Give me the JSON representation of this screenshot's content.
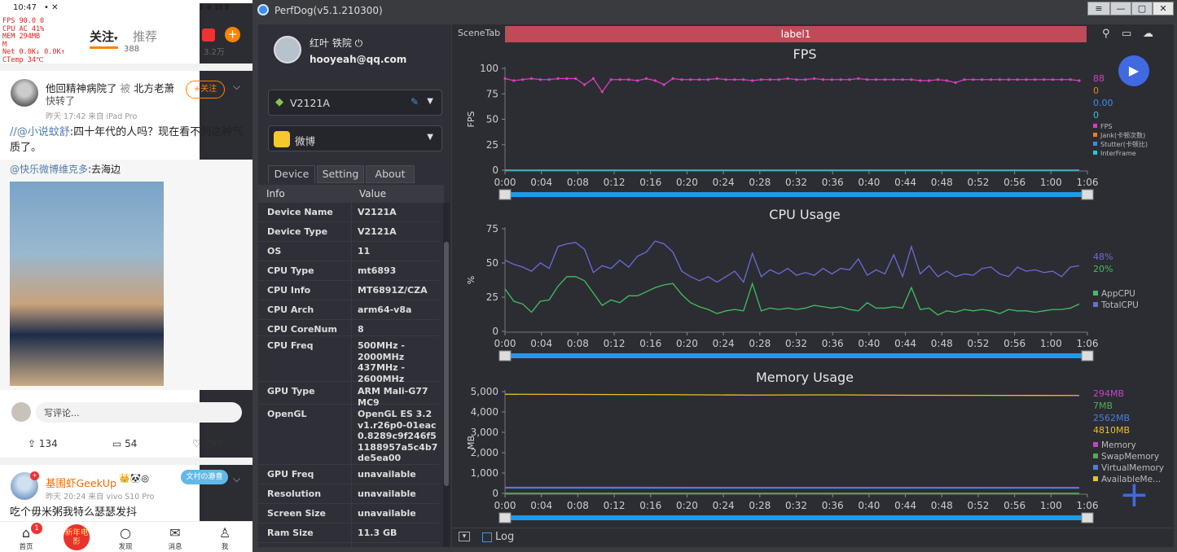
{
  "phone": {
    "status_time": "10:47",
    "status_icons": "• ✕",
    "status_right": "▮ ◉ ▮▮ ▮",
    "overlay": [
      "FPS  90.0  0",
      "CPU  AC  41%",
      "MEM  294MB",
      "M",
      "Net  0.0K↓  0.0K↑",
      "CTemp 34℃"
    ],
    "tab_active": "关注",
    "tab_arrow": "▾",
    "tab_other": "推荐",
    "plus": "+",
    "prev_counts": [
      "388",
      "3.2万"
    ],
    "post1": {
      "name": "他回精神病院了",
      "by": "被",
      "name2": "北方老萧",
      "action": "快转了",
      "meta": "昨天 17:42  来自 iPad Pro",
      "follow": "+关注",
      "text_mention": "//@小说蚊舒",
      "text_body": ":四十年代的人吗？现在看不到这种气质了。",
      "repost_mention": "@快乐微博维克多",
      "repost_body": ":去海边",
      "comment_placeholder": "写评论...",
      "reposts": "134",
      "comments": "54",
      "likes": "297"
    },
    "post2": {
      "name": "基围虾GeekUp",
      "emoji": "👑🐼◎",
      "meta": "昨天 20:24  来自 vivo S10 Pro",
      "text": "吃个毋米粥我特么瑟瑟发抖",
      "stamp": "文村の瀞豊"
    },
    "bottom_nav": [
      {
        "label": "首页",
        "icon": "⌂"
      },
      {
        "label": "",
        "icon": ""
      },
      {
        "label": "发现",
        "icon": "○"
      },
      {
        "label": "消息",
        "icon": "✉"
      },
      {
        "label": "我",
        "icon": "♙"
      }
    ],
    "home_badge": "1",
    "center_badge": "新年电影"
  },
  "app": {
    "title": "PerfDog(v5.1.210300)",
    "win_buttons": [
      "≡",
      "—",
      "▢",
      "✕"
    ],
    "user_name": "红叶 铁院 ⏻",
    "user_email": "hooyeah@qq.com",
    "device": "V2121A",
    "device_icon": "✎",
    "dd_arrow": "▼",
    "app_name": "微博",
    "tabs": [
      "Device",
      "Setting",
      "About"
    ],
    "table_headers": [
      "Info",
      "Value"
    ],
    "rows": [
      {
        "k": "Device Name",
        "v": "V2121A"
      },
      {
        "k": "Device Type",
        "v": "V2121A"
      },
      {
        "k": "OS",
        "v": "11"
      },
      {
        "k": "CPU Type",
        "v": "mt6893"
      },
      {
        "k": "CPU Info",
        "v": "MT6891Z/CZA"
      },
      {
        "k": "CPU Arch",
        "v": "arm64-v8a"
      },
      {
        "k": "CPU CoreNum",
        "v": "8"
      },
      {
        "k": "CPU Freq",
        "v": "500MHz - 2000MHz 437MHz - 2600MHz"
      },
      {
        "k": "GPU Type",
        "v": "ARM Mali-G77 MC9"
      },
      {
        "k": "OpenGL",
        "v": "OpenGL ES 3.2 v1.r26p0-01eac0.8289c9f246f51188957a5c4b7de5ea00"
      },
      {
        "k": "GPU Freq",
        "v": "unavailable"
      },
      {
        "k": "Resolution",
        "v": "unavailable"
      },
      {
        "k": "Screen Size",
        "v": "unavailable"
      },
      {
        "k": "Ram Size",
        "v": "11.3 GB"
      }
    ],
    "scene_tab": "SceneTab",
    "label1": "label1",
    "top_icons": [
      "⚲",
      "▭",
      "☁"
    ],
    "play": "▶",
    "plus_btn": "+",
    "log_label": "Log",
    "log_arrow": "▾",
    "colors": {
      "fps": "#d63fbd",
      "jank": "#f07e1e",
      "stutter": "#3a8ee6",
      "interframe": "#26c6da",
      "appcpu": "#3fbf5f",
      "totalcpu": "#6b6bd6",
      "memory": "#c542c9",
      "swap": "#4caf50",
      "virtual": "#4a7ee0",
      "available": "#e6c229",
      "slider": "#1e9be8"
    }
  },
  "chart_data": [
    {
      "type": "line",
      "title": "FPS",
      "ylabel": "FPS",
      "ylim": [
        0,
        100
      ],
      "yticks": [
        0,
        25,
        50,
        75,
        100
      ],
      "xticks": [
        "0:00",
        "0:04",
        "0:08",
        "0:12",
        "0:16",
        "0:20",
        "0:24",
        "0:28",
        "0:32",
        "0:36",
        "0:40",
        "0:44",
        "0:48",
        "0:52",
        "0:56",
        "1:00",
        "1:06"
      ],
      "x_max_seconds": 66,
      "series": [
        {
          "name": "FPS",
          "label_sub": "",
          "color": "#d63fbd",
          "last": "88",
          "values": [
            90,
            88,
            89,
            90,
            89,
            89,
            90,
            90,
            90,
            84,
            90,
            77,
            89,
            89,
            89,
            88,
            90,
            88,
            84,
            90,
            89,
            89,
            89,
            89,
            90,
            89,
            89,
            89,
            88,
            89,
            89,
            89,
            90,
            89,
            89,
            90,
            89,
            89,
            89,
            89,
            90,
            89,
            89,
            89,
            89,
            89,
            89,
            88,
            88,
            89,
            88,
            86,
            89,
            89,
            89,
            89,
            89,
            89,
            89,
            89,
            89,
            89,
            89,
            89,
            89,
            88
          ]
        },
        {
          "name": "Jank",
          "label_sub": "(卡顿次数)",
          "color": "#f07e1e",
          "last": "0",
          "values": [
            0,
            0
          ]
        },
        {
          "name": "Stutter",
          "label_sub": "(卡顿比)",
          "color": "#3a8ee6",
          "last": "0.00",
          "values": [
            0,
            0
          ]
        },
        {
          "name": "InterFrame",
          "label_sub": "",
          "color": "#26c6da",
          "last": "0",
          "values": [
            0,
            0
          ]
        }
      ]
    },
    {
      "type": "line",
      "title": "CPU Usage",
      "ylabel": "%",
      "ylim": [
        0,
        75
      ],
      "yticks": [
        0,
        25,
        50,
        75
      ],
      "xticks": [
        "0:00",
        "0:04",
        "0:08",
        "0:12",
        "0:16",
        "0:20",
        "0:24",
        "0:28",
        "0:32",
        "0:36",
        "0:40",
        "0:44",
        "0:48",
        "0:52",
        "0:56",
        "1:00",
        "1:06"
      ],
      "x_max_seconds": 66,
      "series": [
        {
          "name": "AppCPU",
          "color": "#3fbf5f",
          "last": "20%",
          "values": [
            31,
            22,
            20,
            14,
            22,
            23,
            33,
            40,
            40,
            37,
            28,
            19,
            23,
            21,
            26,
            26,
            29,
            32,
            34,
            35,
            27,
            21,
            18,
            16,
            13,
            15,
            16,
            15,
            35,
            15,
            17,
            16,
            17,
            16,
            17,
            19,
            18,
            17,
            18,
            16,
            15,
            21,
            17,
            17,
            18,
            17,
            32,
            16,
            17,
            12,
            15,
            14,
            16,
            15,
            16,
            15,
            13,
            16,
            15,
            15,
            14,
            15,
            16,
            16,
            17,
            20
          ]
        },
        {
          "name": "TotalCPU",
          "color": "#6b6bd6",
          "last": "48%",
          "values": [
            52,
            49,
            47,
            44,
            50,
            46,
            62,
            64,
            65,
            60,
            43,
            48,
            46,
            52,
            47,
            55,
            58,
            66,
            64,
            58,
            44,
            40,
            37,
            40,
            36,
            40,
            44,
            36,
            57,
            40,
            45,
            42,
            46,
            41,
            43,
            41,
            46,
            42,
            46,
            45,
            53,
            41,
            45,
            42,
            56,
            40,
            62,
            42,
            48,
            40,
            44,
            40,
            42,
            41,
            46,
            47,
            42,
            40,
            47,
            44,
            45,
            43,
            44,
            40,
            47,
            48
          ]
        }
      ]
    },
    {
      "type": "line",
      "title": "Memory Usage",
      "ylabel": "MB",
      "ylim": [
        0,
        5000
      ],
      "yticks": [
        0,
        1000,
        2000,
        3000,
        4000,
        5000
      ],
      "ytick_labels": [
        "0",
        "1,000",
        "2,000",
        "3,000",
        "4,000",
        "5,000"
      ],
      "xticks": [
        "0:00",
        "0:04",
        "0:08",
        "0:12",
        "0:16",
        "0:20",
        "0:24",
        "0:28",
        "0:32",
        "0:36",
        "0:40",
        "0:44",
        "0:48",
        "0:52",
        "0:56",
        "1:00",
        "1:06"
      ],
      "x_max_seconds": 66,
      "series": [
        {
          "name": "Memory",
          "color": "#c542c9",
          "last": "294MB",
          "values": [
            300,
            295,
            294
          ]
        },
        {
          "name": "SwapMemory",
          "color": "#4caf50",
          "last": "7MB",
          "values": [
            7,
            7,
            7
          ]
        },
        {
          "name": "VirtualMemory",
          "color": "#4a7ee0",
          "last": "2562MB",
          "values": [
            260,
            255,
            256
          ]
        },
        {
          "name": "AvailableMe...",
          "color": "#e6c229",
          "last": "4810MB",
          "values": [
            4870,
            4860,
            4850,
            4830,
            4840,
            4820,
            4815,
            4810
          ]
        }
      ]
    }
  ]
}
